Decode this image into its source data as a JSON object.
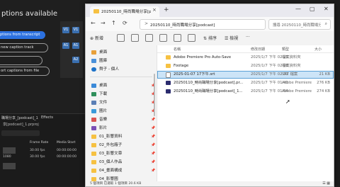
{
  "premiere": {
    "captions_title": "ptions available",
    "btn_transcript": "ptions from transcript",
    "btn_new_track": "new caption track",
    "btn_import": "ort captions from file",
    "btn_other": "",
    "track_labels": [
      "V1",
      "V1",
      "A1",
      "A1",
      "A2"
    ],
    "project_tab": "職場分享_[podcast]_1",
    "effects_tab": "Effects",
    "project_file": "享[podcast]_1.prproj",
    "col_frame_rate": "Frame Rate",
    "col_media_start": "Media Start",
    "rows": [
      {
        "name": "",
        "fps": "30.00 fps",
        "start": "00:00:00:00"
      },
      {
        "name": "1080",
        "fps": "30.00 fps",
        "start": "00:00:00:00"
      },
      {
        "name": "",
        "fps": "",
        "start": ""
      }
    ],
    "colors": {
      "accent": "#2c71e0"
    }
  },
  "explorer": {
    "tab_title": "20250110_時尚職場分享[podcast]",
    "tab_close": "×",
    "new_tab": "+",
    "window_buttons": [
      "—",
      "▢",
      "✕"
    ],
    "address": "20250110_時尚職場分享[podcast]",
    "crumb_sep": ">",
    "search_placeholder": "搜尋 20250110_時尚職場分享[podcast]",
    "toolbar": {
      "new": "新增",
      "sort": "排序",
      "view": "檢視",
      "more": "···"
    },
    "nav": [
      {
        "label": "桌面",
        "icon": "home-icon"
      },
      {
        "label": "圖庫",
        "icon": "gallery-icon"
      },
      {
        "label": "舜子 - 個人",
        "icon": "cloud-icon"
      },
      {
        "label": "桌面",
        "icon": "desktop-icon"
      },
      {
        "label": "下載",
        "icon": "download-icon"
      },
      {
        "label": "文件",
        "icon": "document-icon"
      },
      {
        "label": "圖片",
        "icon": "picture-icon"
      },
      {
        "label": "音樂",
        "icon": "music-icon"
      },
      {
        "label": "影片",
        "icon": "video-icon"
      },
      {
        "label": "01_影響資料",
        "icon": "folder-icon"
      },
      {
        "label": "02_外包廠子",
        "icon": "folder-icon"
      },
      {
        "label": "03_影響文章",
        "icon": "folder-icon"
      },
      {
        "label": "03_個人作品",
        "icon": "folder-icon"
      },
      {
        "label": "04_畫面構成",
        "icon": "folder-icon"
      },
      {
        "label": "04_影響圖",
        "icon": "folder-icon"
      }
    ],
    "columns": {
      "name": "名稱",
      "date": "修改日期",
      "type": "類型",
      "size": "大小"
    },
    "files": [
      {
        "name": "Adobe Premiere Pro Auto-Save",
        "date": "2025/1/7 下午 02:25",
        "type": "檔案資料夾",
        "size": "",
        "icon": "folder-icon",
        "selected": false
      },
      {
        "name": "Footage",
        "date": "2025/1/7 下午 02:08",
        "type": "檔案資料夾",
        "size": "",
        "icon": "folder-icon",
        "selected": false
      },
      {
        "name": "2025-01-07 17下午.srt",
        "date": "2025/1/7 下午 02:31",
        "type": "SRT 檔案",
        "size": "21 KB",
        "icon": "file-icon",
        "selected": true
      },
      {
        "name": "20250110_時尚職場分享[podcast].pr...",
        "date": "2025/1/7 下午 01:41",
        "type": "Adobe Premiere Pr...",
        "size": "276 KB",
        "icon": "premiere-file-icon",
        "selected": false
      },
      {
        "name": "20250110_時尚職場分享[podcast]_1...",
        "date": "2025/1/7 下午 01:54",
        "type": "Adobe Premiere Pr...",
        "size": "274 KB",
        "icon": "premiere-file-icon",
        "selected": false
      }
    ],
    "status": "5 個項目  已選取 1 個項目 20.6 KB",
    "colors": {
      "folder": "#f6c142",
      "selection": "#cce4f7",
      "premiere": "#2b2c6e"
    }
  }
}
